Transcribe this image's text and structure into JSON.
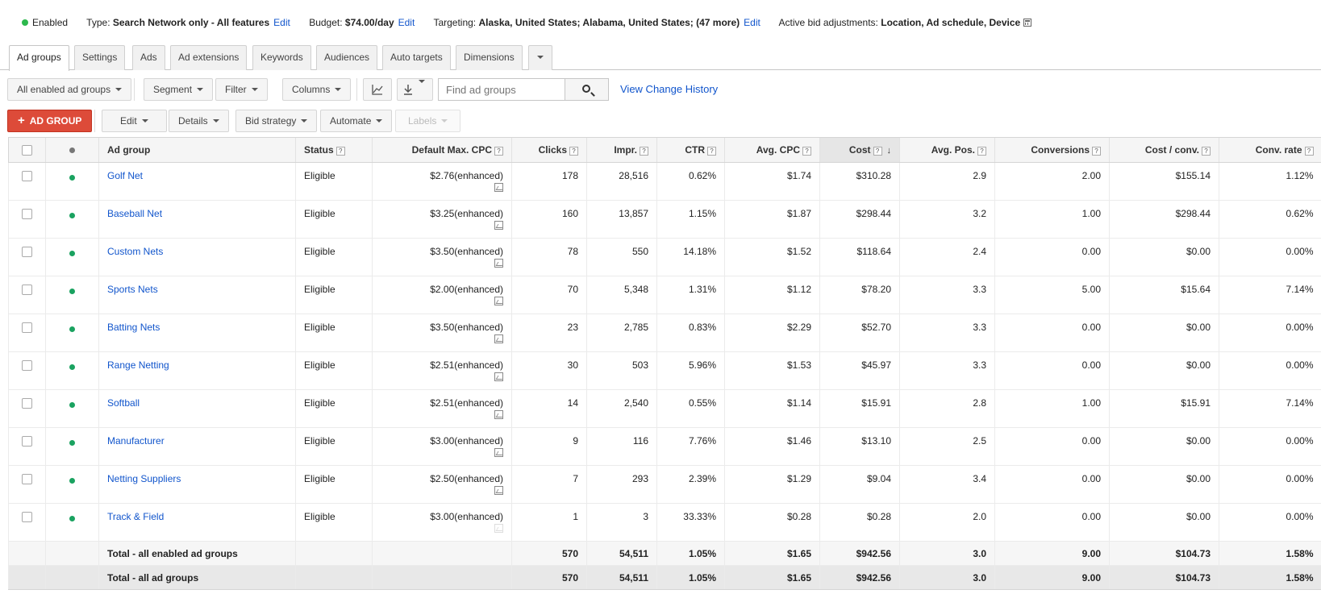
{
  "status": {
    "state": "Enabled",
    "type_label": "Type:",
    "type_value": "Search Network only - All features",
    "budget_label": "Budget:",
    "budget_value": "$74.00/day",
    "targeting_label": "Targeting:",
    "targeting_value": "Alaska, United States; Alabama, United States; (47 more)",
    "bid_label": "Active bid adjustments:",
    "bid_value": "Location, Ad schedule, Device",
    "edit": "Edit"
  },
  "tabs": [
    "Ad groups",
    "Settings",
    "Ads",
    "Ad extensions",
    "Keywords",
    "Audiences",
    "Auto targets",
    "Dimensions"
  ],
  "toolbar1": {
    "filter_view": "All enabled ad groups",
    "segment": "Segment",
    "filter": "Filter",
    "columns": "Columns",
    "search_placeholder": "Find ad groups",
    "change_history": "View Change History"
  },
  "toolbar2": {
    "add": "AD GROUP",
    "edit": "Edit",
    "details": "Details",
    "bid_strategy": "Bid strategy",
    "automate": "Automate",
    "labels": "Labels"
  },
  "columns": [
    "Ad group",
    "Status",
    "Default Max. CPC",
    "Clicks",
    "Impr.",
    "CTR",
    "Avg. CPC",
    "Cost",
    "Avg. Pos.",
    "Conversions",
    "Cost / conv.",
    "Conv. rate"
  ],
  "rows": [
    {
      "name": "Golf Net",
      "status": "Eligible",
      "cpc": "$2.76(enhanced)",
      "clicks": "178",
      "impr": "28,516",
      "ctr": "0.62%",
      "avg_cpc": "$1.74",
      "cost": "$310.28",
      "pos": "2.9",
      "conv": "2.00",
      "cost_conv": "$155.14",
      "conv_rate": "1.12%"
    },
    {
      "name": "Baseball Net",
      "status": "Eligible",
      "cpc": "$3.25(enhanced)",
      "clicks": "160",
      "impr": "13,857",
      "ctr": "1.15%",
      "avg_cpc": "$1.87",
      "cost": "$298.44",
      "pos": "3.2",
      "conv": "1.00",
      "cost_conv": "$298.44",
      "conv_rate": "0.62%"
    },
    {
      "name": "Custom Nets",
      "status": "Eligible",
      "cpc": "$3.50(enhanced)",
      "clicks": "78",
      "impr": "550",
      "ctr": "14.18%",
      "avg_cpc": "$1.52",
      "cost": "$118.64",
      "pos": "2.4",
      "conv": "0.00",
      "cost_conv": "$0.00",
      "conv_rate": "0.00%"
    },
    {
      "name": "Sports Nets",
      "status": "Eligible",
      "cpc": "$2.00(enhanced)",
      "clicks": "70",
      "impr": "5,348",
      "ctr": "1.31%",
      "avg_cpc": "$1.12",
      "cost": "$78.20",
      "pos": "3.3",
      "conv": "5.00",
      "cost_conv": "$15.64",
      "conv_rate": "7.14%"
    },
    {
      "name": "Batting Nets",
      "status": "Eligible",
      "cpc": "$3.50(enhanced)",
      "clicks": "23",
      "impr": "2,785",
      "ctr": "0.83%",
      "avg_cpc": "$2.29",
      "cost": "$52.70",
      "pos": "3.3",
      "conv": "0.00",
      "cost_conv": "$0.00",
      "conv_rate": "0.00%"
    },
    {
      "name": "Range Netting",
      "status": "Eligible",
      "cpc": "$2.51(enhanced)",
      "clicks": "30",
      "impr": "503",
      "ctr": "5.96%",
      "avg_cpc": "$1.53",
      "cost": "$45.97",
      "pos": "3.3",
      "conv": "0.00",
      "cost_conv": "$0.00",
      "conv_rate": "0.00%"
    },
    {
      "name": "Softball",
      "status": "Eligible",
      "cpc": "$2.51(enhanced)",
      "clicks": "14",
      "impr": "2,540",
      "ctr": "0.55%",
      "avg_cpc": "$1.14",
      "cost": "$15.91",
      "pos": "2.8",
      "conv": "1.00",
      "cost_conv": "$15.91",
      "conv_rate": "7.14%"
    },
    {
      "name": "Manufacturer",
      "status": "Eligible",
      "cpc": "$3.00(enhanced)",
      "clicks": "9",
      "impr": "116",
      "ctr": "7.76%",
      "avg_cpc": "$1.46",
      "cost": "$13.10",
      "pos": "2.5",
      "conv": "0.00",
      "cost_conv": "$0.00",
      "conv_rate": "0.00%"
    },
    {
      "name": "Netting Suppliers",
      "status": "Eligible",
      "cpc": "$2.50(enhanced)",
      "clicks": "7",
      "impr": "293",
      "ctr": "2.39%",
      "avg_cpc": "$1.29",
      "cost": "$9.04",
      "pos": "3.4",
      "conv": "0.00",
      "cost_conv": "$0.00",
      "conv_rate": "0.00%"
    },
    {
      "name": "Track & Field",
      "status": "Eligible",
      "cpc": "$3.00(enhanced)",
      "clicks": "1",
      "impr": "3",
      "ctr": "33.33%",
      "avg_cpc": "$0.28",
      "cost": "$0.28",
      "pos": "2.0",
      "conv": "0.00",
      "cost_conv": "$0.00",
      "conv_rate": "0.00%"
    }
  ],
  "totals": [
    {
      "label": "Total - all enabled ad groups",
      "clicks": "570",
      "impr": "54,511",
      "ctr": "1.05%",
      "avg_cpc": "$1.65",
      "cost": "$942.56",
      "pos": "3.0",
      "conv": "9.00",
      "cost_conv": "$104.73",
      "conv_rate": "1.58%"
    },
    {
      "label": "Total - all ad groups",
      "clicks": "570",
      "impr": "54,511",
      "ctr": "1.05%",
      "avg_cpc": "$1.65",
      "cost": "$942.56",
      "pos": "3.0",
      "conv": "9.00",
      "cost_conv": "$104.73",
      "conv_rate": "1.58%"
    }
  ],
  "colors": {
    "accent_red": "#dd4b39",
    "link_blue": "#1155cc",
    "status_green": "#1aa260"
  }
}
